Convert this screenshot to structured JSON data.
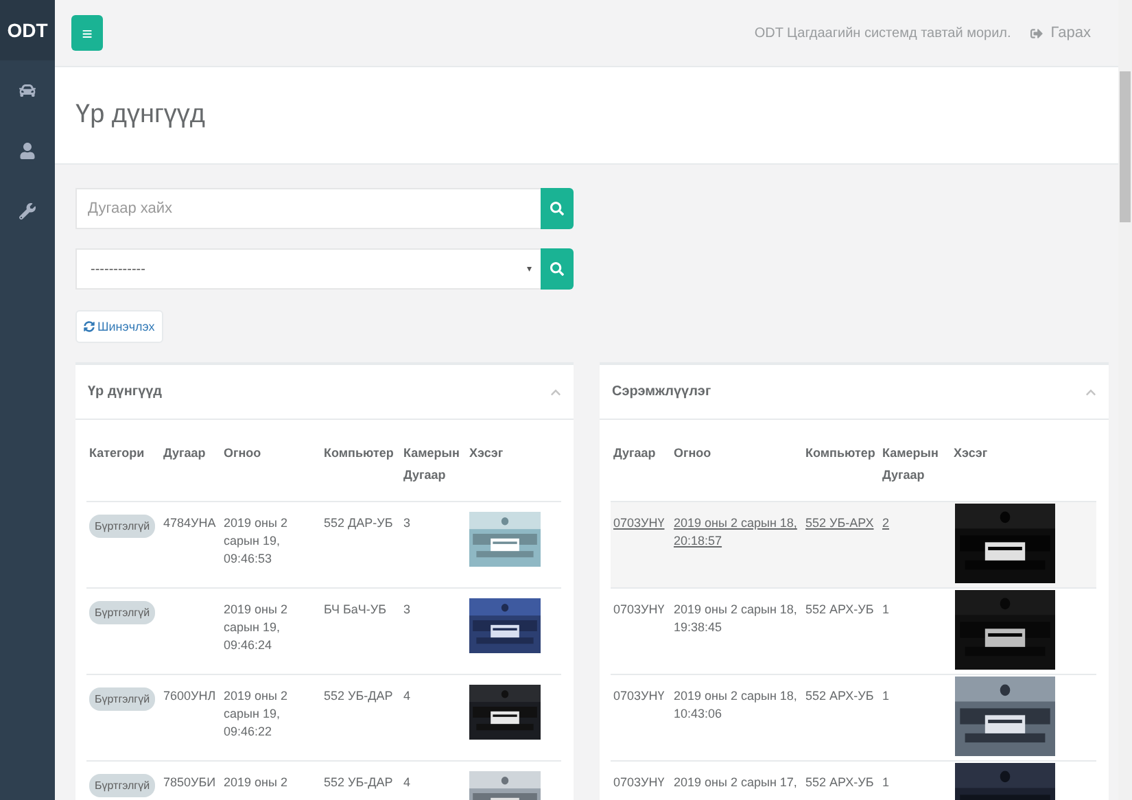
{
  "sidebar": {
    "logo": "ODT"
  },
  "topbar": {
    "menu_button": "≡",
    "welcome": "ODT Цагдаагийн системд тавтай морил.",
    "logout": "Гарах"
  },
  "page_title": "Үр дүнгүүд",
  "search": {
    "placeholder": "Дугаар хайх"
  },
  "filter": {
    "value": "------------",
    "caret": "▾"
  },
  "refresh_button": "Шинэчлэх",
  "results_panel": {
    "title": "Үр дүнгүүд",
    "columns": [
      "Категори",
      "Дугаар",
      "Огноо",
      "Компьютер",
      "Камерын Дугаар",
      "Хэсэг"
    ],
    "rows": [
      {
        "category": "Бүртгэлгүй",
        "plate": "4784УНА",
        "date": "2019 оны 2 сарын 19, 09:46:53",
        "computer": "552 ДАР-УБ",
        "camera": "3"
      },
      {
        "category": "Бүртгэлгүй",
        "plate": "",
        "date": "2019 оны 2 сарын 19, 09:46:24",
        "computer": "БЧ БаЧ-УБ",
        "camera": "3"
      },
      {
        "category": "Бүртгэлгүй",
        "plate": "7600УНЛ",
        "date": "2019 оны 2 сарын 19, 09:46:22",
        "computer": "552 УБ-ДАР",
        "camera": "4"
      },
      {
        "category": "Бүртгэлгүй",
        "plate": "7850УБИ",
        "date": "2019 оны 2",
        "computer": "552 УБ-ДАР",
        "camera": "4"
      }
    ]
  },
  "alerts_panel": {
    "title": "Сэрэмжлүүлэг",
    "columns": [
      "Дугаар",
      "Огноо",
      "Компьютер",
      "Камерын Дугаар",
      "Хэсэг"
    ],
    "rows": [
      {
        "plate": "0703УНҮ",
        "date": "2019 оны 2 сарын 18, 20:18:57",
        "computer": "552 УБ-АРХ",
        "camera": "2",
        "selected": true
      },
      {
        "plate": "0703УНҮ",
        "date": "2019 оны 2 сарын 18, 19:38:45",
        "computer": "552 АРХ-УБ",
        "camera": "1",
        "selected": false
      },
      {
        "plate": "0703УНҮ",
        "date": "2019 оны 2 сарын 18, 10:43:06",
        "computer": "552 АРХ-УБ",
        "camera": "1",
        "selected": false
      },
      {
        "plate": "0703УНҮ",
        "date": "2019 оны 2 сарын 17,",
        "computer": "552 АРХ-УБ",
        "camera": "1",
        "selected": false
      }
    ]
  }
}
